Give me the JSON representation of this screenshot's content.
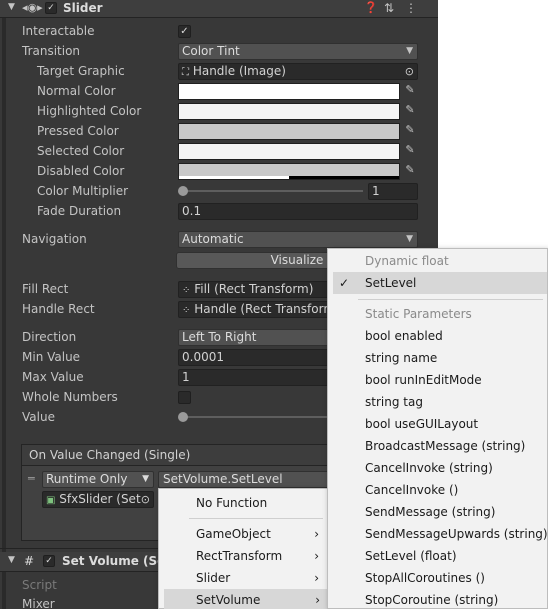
{
  "component": {
    "title": "Slider",
    "enabled_check": "✓"
  },
  "rows": {
    "interactable": {
      "label": "Interactable",
      "value": "✓"
    },
    "transition": {
      "label": "Transition",
      "value": "Color Tint"
    },
    "target_graphic": {
      "label": "Target Graphic",
      "value": "Handle (Image)"
    },
    "normal_color": {
      "label": "Normal Color",
      "color": "#ffffff"
    },
    "highlighted_color": {
      "label": "Highlighted Color",
      "color": "#f5f5f5"
    },
    "pressed_color": {
      "label": "Pressed Color",
      "color": "#c8c8c8"
    },
    "selected_color": {
      "label": "Selected Color",
      "color": "#f5f5f5"
    },
    "disabled_color": {
      "label": "Disabled Color",
      "color": "#c8c8c8"
    },
    "color_multiplier": {
      "label": "Color Multiplier",
      "value": "1"
    },
    "fade_duration": {
      "label": "Fade Duration",
      "value": "0.1"
    },
    "navigation": {
      "label": "Navigation",
      "value": "Automatic"
    },
    "visualize": {
      "label": "Visualize"
    },
    "fill_rect": {
      "label": "Fill Rect",
      "value": "Fill (Rect Transform)"
    },
    "handle_rect": {
      "label": "Handle Rect",
      "value": "Handle (Rect Transform)"
    },
    "direction": {
      "label": "Direction",
      "value": "Left To Right"
    },
    "min_value": {
      "label": "Min Value",
      "value": "0.0001"
    },
    "max_value": {
      "label": "Max Value",
      "value": "1"
    },
    "whole_numbers": {
      "label": "Whole Numbers"
    },
    "value": {
      "label": "Value"
    }
  },
  "event": {
    "header": "On Value Changed (Single)",
    "runtime": "Runtime Only",
    "function": "SetVolume.SetLevel",
    "object": "SfxSlider (Set"
  },
  "component2": {
    "title": "Set Volume (Scr",
    "script_label": "Script",
    "mixer_label": "Mixer"
  },
  "left_menu": {
    "items": [
      "No Function",
      "GameObject",
      "RectTransform",
      "Slider",
      "SetVolume"
    ]
  },
  "right_menu": {
    "dynamic_header": "Dynamic float",
    "dynamic_items": [
      "SetLevel"
    ],
    "static_header": "Static Parameters",
    "static_items": [
      "bool enabled",
      "string name",
      "bool runInEditMode",
      "string tag",
      "bool useGUILayout",
      "BroadcastMessage (string)",
      "CancelInvoke (string)",
      "CancelInvoke ()",
      "SendMessage (string)",
      "SendMessageUpwards (string)",
      "SetLevel (float)",
      "StopAllCoroutines ()",
      "StopCoroutine (string)"
    ]
  }
}
